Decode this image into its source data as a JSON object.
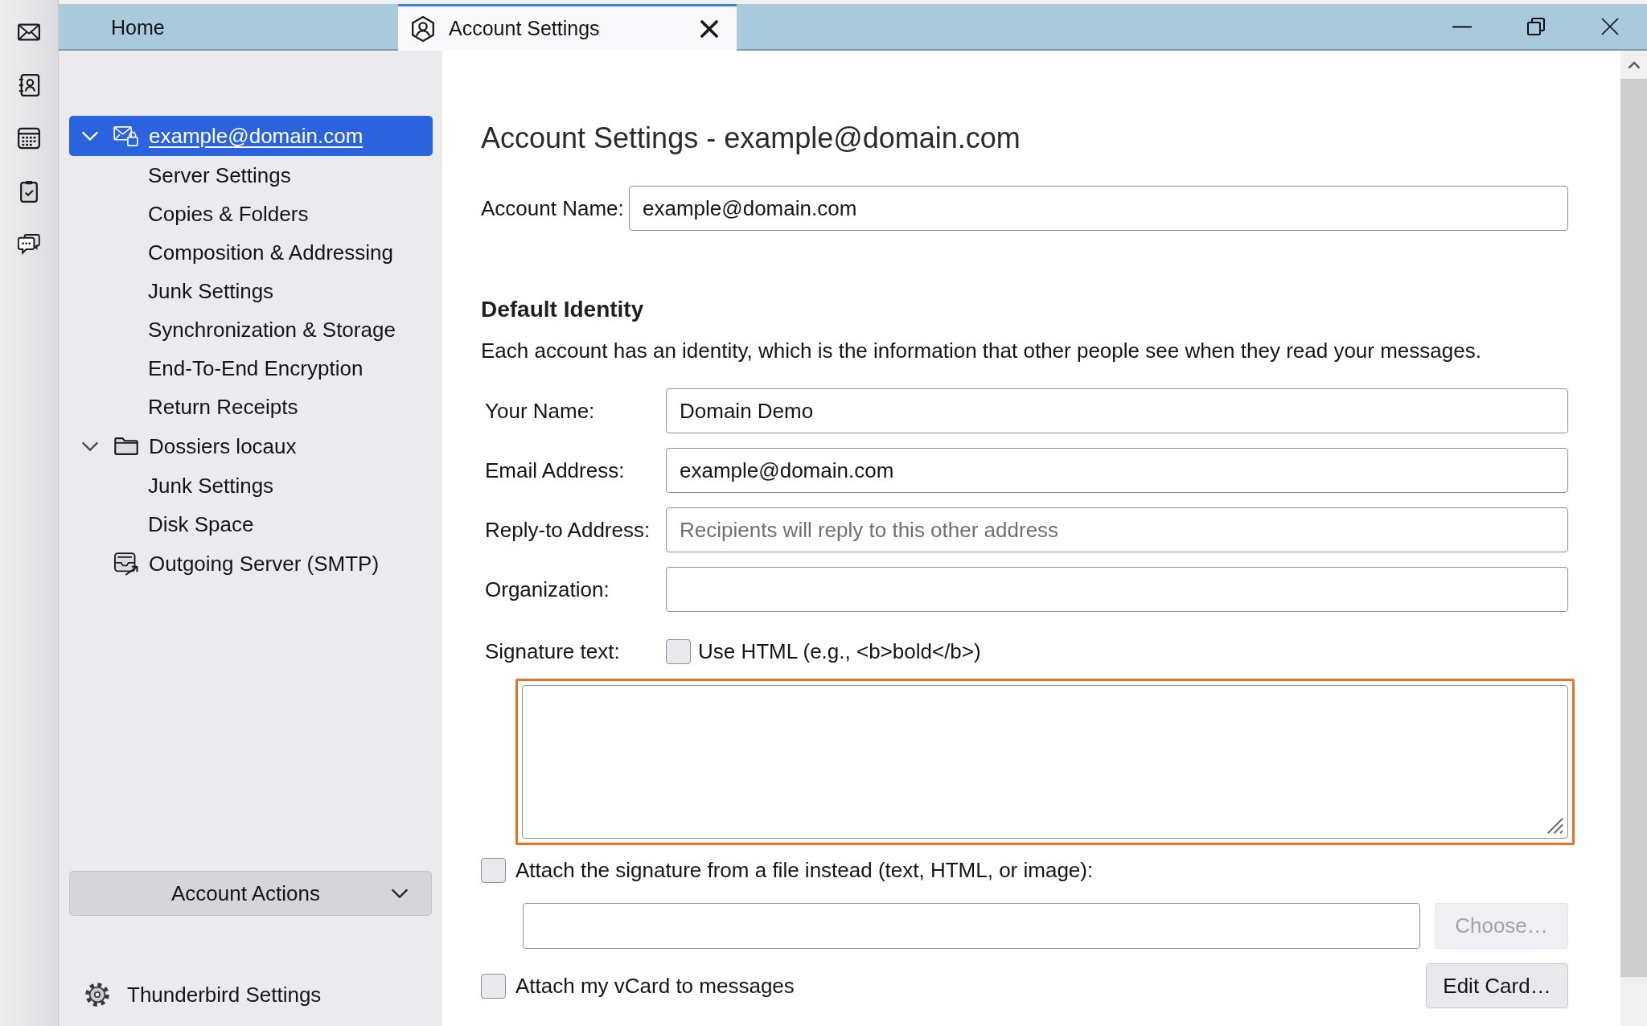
{
  "tabs": [
    {
      "label": "Home",
      "kind": "home",
      "selected": false,
      "closable": false
    },
    {
      "label": "Account Settings",
      "kind": "account",
      "selected": true,
      "closable": true
    }
  ],
  "sidebar": {
    "tree": [
      {
        "label": "example@domain.com",
        "kind": "account",
        "expanded": true,
        "selected": true,
        "children": [
          {
            "label": "Server Settings",
            "selected": false
          },
          {
            "label": "Copies & Folders",
            "selected": false
          },
          {
            "label": "Composition & Addressing",
            "selected": false
          },
          {
            "label": "Junk Settings",
            "selected": false
          },
          {
            "label": "Synchronization & Storage",
            "selected": false
          },
          {
            "label": "End-To-End Encryption",
            "selected": false
          },
          {
            "label": "Return Receipts",
            "selected": false
          }
        ]
      },
      {
        "label": "Dossiers locaux",
        "kind": "folder",
        "expanded": true,
        "selected": false,
        "children": [
          {
            "label": "Junk Settings",
            "selected": false
          },
          {
            "label": "Disk Space",
            "selected": false
          }
        ]
      },
      {
        "label": "Outgoing Server (SMTP)",
        "kind": "smtp",
        "selected": false
      }
    ],
    "account_actions": {
      "label": "Account Actions"
    },
    "settings_link": {
      "label": "Thunderbird Settings"
    }
  },
  "content": {
    "title": "Account Settings - example@domain.com",
    "account_name": {
      "label": "Account Name:",
      "value": "example@domain.com"
    },
    "identity": {
      "heading": "Default Identity",
      "description": "Each account has an identity, which is the information that other people see when they read your messages.",
      "fields": [
        {
          "label": "Your Name:",
          "value": "Domain Demo"
        },
        {
          "label": "Email Address:",
          "value": "example@domain.com"
        },
        {
          "label": "Reply-to Address:",
          "placeholder": "Recipients will reply to this other address"
        },
        {
          "label": "Organization:"
        }
      ],
      "signature": {
        "label": "Signature text:",
        "use_html": {
          "label": "Use HTML (e.g., <b>bold</b>)",
          "checked": false
        },
        "focused": true
      },
      "attach_file": {
        "label": "Attach the signature from a file instead (text, HTML, or image):",
        "checked": false
      },
      "choose_button": {
        "label": "Choose…",
        "disabled": true
      },
      "vcard": {
        "label": "Attach my vCard to messages",
        "checked": false
      },
      "edit_card_button": {
        "label": "Edit Card…"
      }
    }
  }
}
